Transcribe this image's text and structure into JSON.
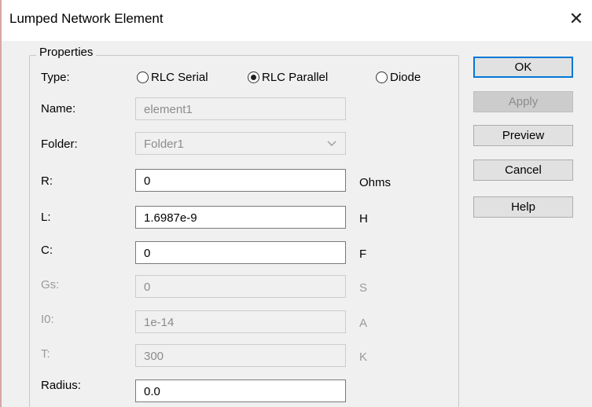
{
  "window": {
    "title": "Lumped Network Element",
    "close_glyph": "✕"
  },
  "properties": {
    "group_label": "Properties",
    "type_label": "Type:",
    "type_options": [
      {
        "label": "RLC Serial",
        "selected": false
      },
      {
        "label": "RLC Parallel",
        "selected": true
      },
      {
        "label": "Diode",
        "selected": false
      }
    ],
    "name_label": "Name:",
    "name_value": "element1",
    "folder_label": "Folder:",
    "folder_value": "Folder1",
    "fields": [
      {
        "label": "R:",
        "value": "0",
        "unit": "Ohms",
        "enabled": true
      },
      {
        "label": "L:",
        "value": "1.6987e-9",
        "unit": "H",
        "enabled": true
      },
      {
        "label": "C:",
        "value": "0",
        "unit": "F",
        "enabled": true
      },
      {
        "label": "Gs:",
        "value": "0",
        "unit": "S",
        "enabled": false
      },
      {
        "label": "I0:",
        "value": "1e-14",
        "unit": "A",
        "enabled": false
      },
      {
        "label": "T:",
        "value": "300",
        "unit": "K",
        "enabled": false
      }
    ],
    "radius_label": "Radius:",
    "radius_value": "0.0"
  },
  "buttons": {
    "ok": "OK",
    "apply": "Apply",
    "preview": "Preview",
    "cancel": "Cancel",
    "help": "Help"
  },
  "icons": {
    "close": "close-icon",
    "dropdown": "chevron-down-icon",
    "radio": "radio-icon"
  },
  "colors": {
    "dialog_bg": "#f0f0f0",
    "default_button_border": "#0078d7",
    "disabled_text": "#8c8c8c"
  }
}
